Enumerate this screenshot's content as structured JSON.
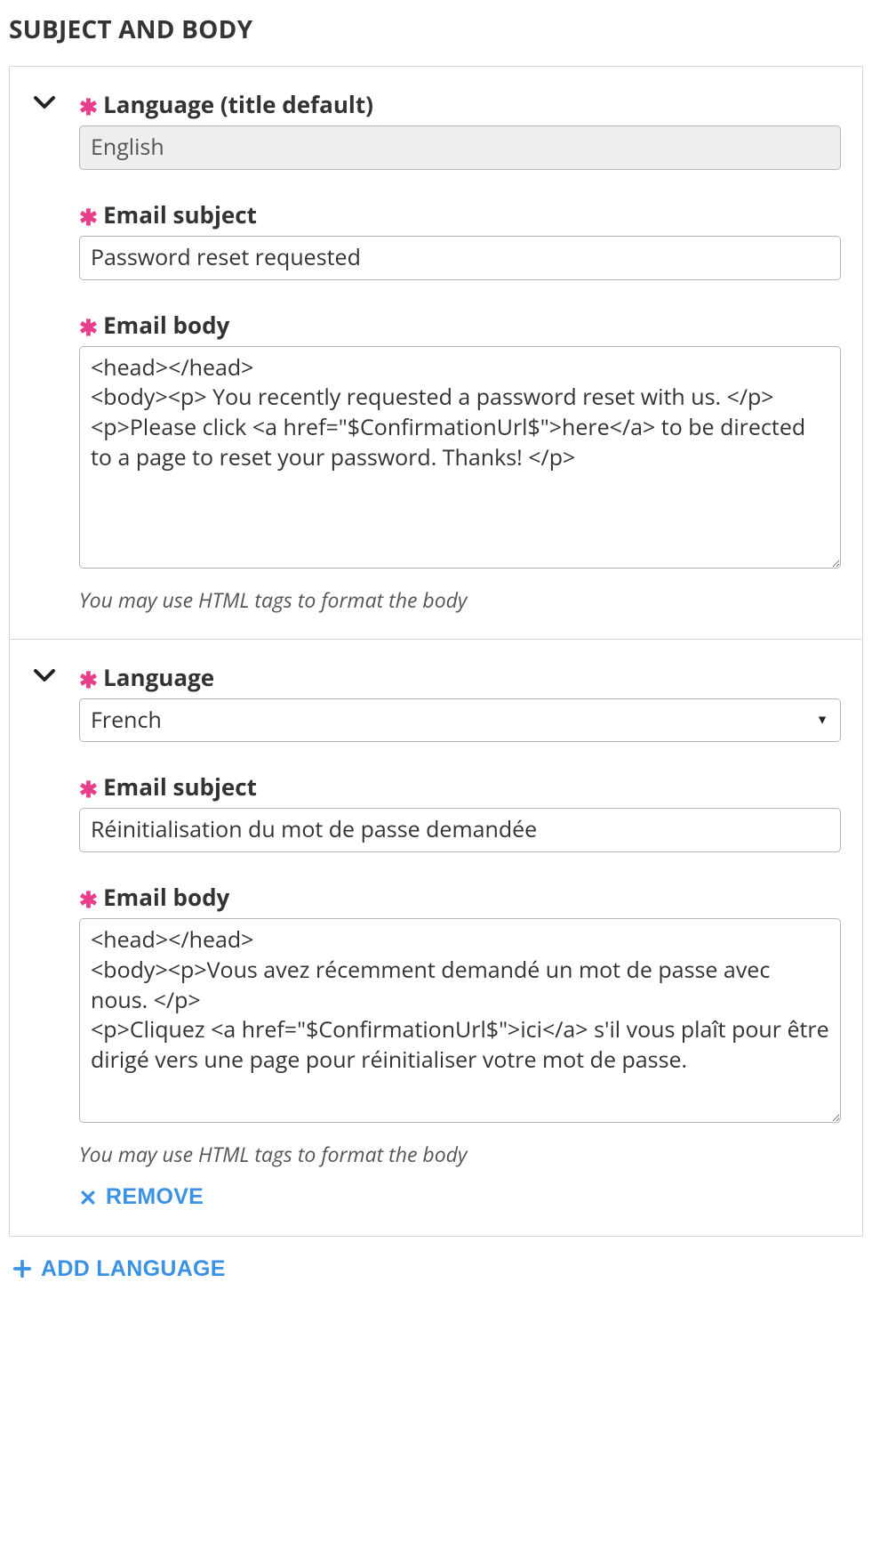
{
  "section_title": "SUBJECT AND BODY",
  "hint_text": "You may use HTML tags to format the body",
  "labels": {
    "language_default": "Language (title default)",
    "language": "Language",
    "subject": "Email subject",
    "body": "Email body"
  },
  "blocks": [
    {
      "language_value": "English",
      "language_disabled": true,
      "subject_value": "Password reset requested",
      "body_value": "<head></head>\n<body><p> You recently requested a password reset with us. </p>\n<p>Please click <a href=\"$ConfirmationUrl$\">here</a> to be directed to a page to reset your password. Thanks! </p>",
      "removable": false
    },
    {
      "language_value": "French",
      "language_disabled": false,
      "subject_value": "Réinitialisation du mot de passe demandée",
      "body_value": "<head></head>\n<body><p>Vous avez récemment demandé un mot de passe avec nous. </p>\n<p>Cliquez <a href=\"$ConfirmationUrl$\">ici</a> s'il vous plaît pour être dirigé vers une page pour réinitialiser votre mot de passe.",
      "removable": true
    }
  ],
  "actions": {
    "remove_label": "REMOVE",
    "add_language_label": "ADD LANGUAGE"
  }
}
